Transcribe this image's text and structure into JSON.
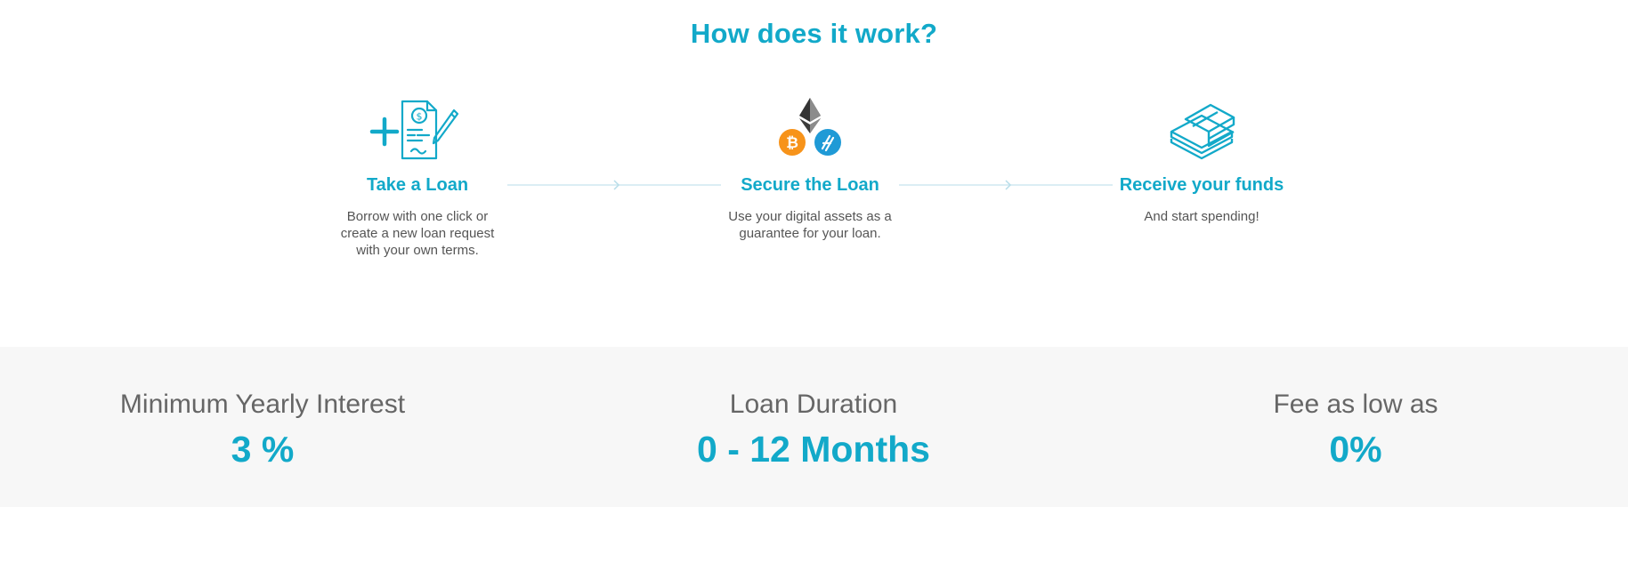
{
  "section": {
    "title": "How does it work?"
  },
  "steps": [
    {
      "icon": "loan-document-icon",
      "title": "Take a Loan",
      "description": "Borrow with one click or create a new loan request with your own terms."
    },
    {
      "icon": "crypto-assets-icon",
      "title": "Secure the Loan",
      "description": "Use your digital assets as a guarantee for your loan."
    },
    {
      "icon": "money-stack-icon",
      "title": "Receive your funds",
      "description": "And start spending!"
    }
  ],
  "stats": [
    {
      "label": "Minimum Yearly Interest",
      "value": "3 %"
    },
    {
      "label": "Loan Duration",
      "value": "0 - 12 Months"
    },
    {
      "label": "Fee as low as",
      "value": "0%"
    }
  ],
  "colors": {
    "accent": "#12a9c9",
    "text": "#555555",
    "band": "#f7f7f7",
    "bitcoin": "#f7931a",
    "token": "#1f9ad6"
  }
}
